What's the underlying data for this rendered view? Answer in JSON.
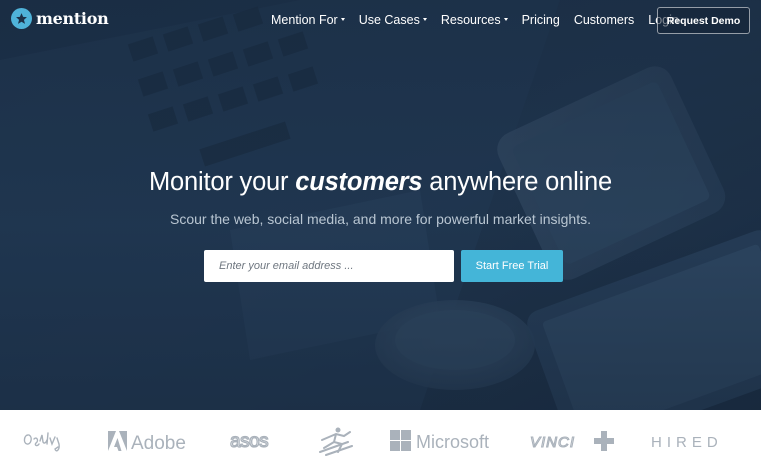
{
  "brand": {
    "name": "mention"
  },
  "nav": {
    "items": [
      {
        "label": "Mention For",
        "dropdown": true
      },
      {
        "label": "Use Cases",
        "dropdown": true
      },
      {
        "label": "Resources",
        "dropdown": true
      },
      {
        "label": "Pricing",
        "dropdown": false
      },
      {
        "label": "Customers",
        "dropdown": false
      },
      {
        "label": "Login",
        "dropdown": false
      }
    ],
    "demo_button": "Request Demo"
  },
  "hero": {
    "headline_start": "Monitor your ",
    "headline_emphasis": "customers",
    "headline_end": " anywhere online",
    "subheadline": "Scour the web, social media, and more for powerful market insights.",
    "email_placeholder": "Enter your email address ...",
    "cta_label": "Start Free Trial"
  },
  "clients": {
    "logos": [
      {
        "name": "Ogilvy",
        "icon": "ogilvy-logo"
      },
      {
        "name": "Adobe",
        "icon": "adobe-logo"
      },
      {
        "name": "asos",
        "icon": "asos-logo"
      },
      {
        "name": "Fédération Française de Ski",
        "icon": "skier-logo"
      },
      {
        "name": "Microsoft",
        "icon": "microsoft-logo"
      },
      {
        "name": "VINCI",
        "icon": "vinci-logo"
      },
      {
        "name": "HIRED",
        "icon": "hired-logo"
      }
    ]
  },
  "colors": {
    "hero_bg": "#1d3147",
    "accent": "#44b5d8",
    "logo_gray": "#aab2bb"
  }
}
